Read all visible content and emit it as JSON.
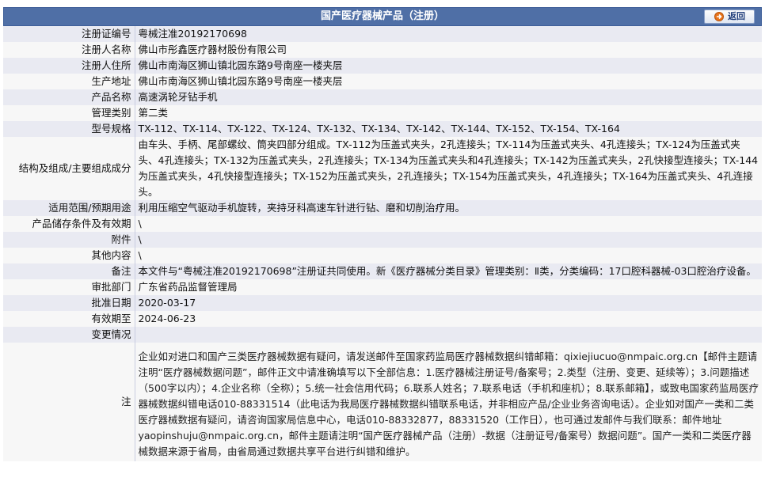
{
  "header": {
    "title": "国产医疗器械产品（注册）",
    "back_label": "返回"
  },
  "fields": [
    {
      "label": "注册证编号",
      "value": "粤械注准20192170698"
    },
    {
      "label": "注册人名称",
      "value": "佛山市彤鑫医疗器材股份有限公司"
    },
    {
      "label": "注册人住所",
      "value": "佛山市南海区狮山镇北园东路9号南座一楼夹层"
    },
    {
      "label": "生产地址",
      "value": "佛山市南海区狮山镇北园东路9号南座一楼夹层"
    },
    {
      "label": "产品名称",
      "value": "高速涡轮牙钻手机"
    },
    {
      "label": "管理类别",
      "value": "第二类"
    },
    {
      "label": "型号规格",
      "value": "TX-112、TX-114、TX-122、TX-124、TX-132、TX-134、TX-142、TX-144、TX-152、TX-154、TX-164"
    },
    {
      "label": "结构及组成/主要组成成分",
      "value": "由车头、手柄、尾部螺纹、筒夹四部分组成。TX-112为压盖式夹头，2孔连接头；TX-114为压盖式夹头、4孔连接头；TX-124为压盖式夹头、4孔连接头；TX-132为压盖式夹头，2孔连接头；TX-134为压盖式夹头和4孔连接头；TX-142为压盖式夹头，2孔快接型连接头；TX-144为压盖式夹头，4孔快接型连接头；TX-152为压盖式夹头，2孔连接头；TX-154为压盖式夹头，4孔连接头；TX-164为压盖式夹头、4孔连接头。"
    },
    {
      "label": "适用范围/预期用途",
      "value": "利用压缩空气驱动手机旋转，夹持牙科高速车针进行钻、磨和切削治疗用。"
    },
    {
      "label": "产品储存条件及有效期",
      "value": "\\"
    },
    {
      "label": "附件",
      "value": "\\"
    },
    {
      "label": "其他内容",
      "value": "\\"
    },
    {
      "label": "备注",
      "value": "本文件与“粤械注准20192170698”注册证共同使用。新《医疗器械分类目录》管理类别：Ⅱ类，分类编码：17口腔科器械-03口腔治疗设备。"
    },
    {
      "label": "审批部门",
      "value": "广东省药品监督管理局"
    },
    {
      "label": "批准日期",
      "value": "2020-03-17"
    },
    {
      "label": "有效期至",
      "value": "2024-06-23"
    },
    {
      "label": "变更情况",
      "value": ""
    },
    {
      "label": "注",
      "value": "企业如对进口和国产三类医疗器械数据有疑问，请发送邮件至国家药监局医疗器械数据纠错邮箱：qixiejiucuo@nmpaic.org.cn【邮件主题请注明“医疗器械数据问题”，邮件正文中请准确填写以下全部信息：1.医疗器械注册证号/备案号；2.类型（注册、变更、延续等）；3.问题描述（500字以内）；4.企业名称（全称）；5.统一社会信用代码；6.联系人姓名；7.联系电话（手机和座机）；8.联系邮箱】，或致电国家药监局医疗器械数据纠错电话010-88331514（此电话为我局医疗器械数据纠错联系电话，并非相应产品/企业业务咨询电话）。企业如对国产一类和二类医疗器械数据有疑问，请咨询国家局信息中心，电话010-88332877，88331520（工作日），也可通过发邮件与我们联系：邮件地址yaopinshuju@nmpaic.org.cn，邮件主题请注明“国产医疗器械产品（注册）-数据（注册证号/备案号）数据问题”。国产一类和二类医疗器械数据来源于省局，由省局通过数据共享平台进行纠错和维护。"
    }
  ],
  "colors": {
    "header_bg": "#4f6fa6",
    "row_odd": "#e9eaf2",
    "row_even": "#f7f7f7"
  },
  "icons": {
    "back": "arrow-right-icon"
  }
}
